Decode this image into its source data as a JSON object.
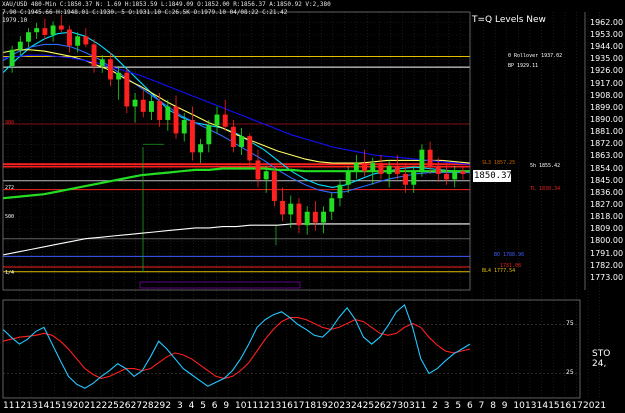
{
  "header": {
    "symbol_line": "XAU/USD 480-Min C:1850.37 N: 1.69 H:1853.59 L:1849.09 O:1852.00 R:1856.37 A:1850.92 V:2,380",
    "ohlc_line": "7.90 C:1945.66 H:1948.01 C:1930. 5 O:1931.10 C:26.5K O:1979.10 04/08:22 C:21.42",
    "corner_value": "1979.10"
  },
  "indicator_title": "T=Q Levels New",
  "current_price": "1850.37",
  "level_labels": [
    {
      "text": "0 Rollover 1937.02",
      "color": "#ffffff",
      "y": 1937.02,
      "x": 508
    },
    {
      "text": "BP 1929.11",
      "color": "#ffffff",
      "y": 1929.11,
      "x": 508
    },
    {
      "text": "SL3 1857.25",
      "color": "#c86400",
      "y": 1857.25,
      "x": 482
    },
    {
      "text": "5h 1855.42",
      "color": "#ffffff",
      "y": 1855.42,
      "x": 530
    },
    {
      "text": "TL 1838.34",
      "color": "#e02020",
      "y": 1838.34,
      "x": 530
    },
    {
      "text": "BO 1788.96",
      "color": "#3c5cff",
      "y": 1788.96,
      "x": 494
    },
    {
      "text": "1781.08",
      "color": "#e02020",
      "y": 1781.08,
      "x": 500
    },
    {
      "text": "BL4 1777.54",
      "color": "#e0c000",
      "y": 1777.54,
      "x": 482
    }
  ],
  "left_markers": [
    {
      "text": "900",
      "y": 1887,
      "color": "#e02020"
    },
    {
      "text": "272",
      "y": 1839,
      "color": "#ffffff"
    },
    {
      "text": "500",
      "y": 1817,
      "color": "#ffffff"
    },
    {
      "text": "1/4",
      "y": 1776,
      "color": "#ffffff"
    }
  ],
  "stochastic_label": "STO 24,",
  "chart_data": {
    "type": "line",
    "title": "XAU/USD 480-Min",
    "ylim": [
      1764,
      1970
    ],
    "y_ticks": [
      1773.0,
      1782.0,
      1791.0,
      1800.0,
      1809.0,
      1818.0,
      1827.0,
      1836.0,
      1845.0,
      1854.0,
      1863.0,
      1872.0,
      1881.0,
      1890.0,
      1899.0,
      1908.0,
      1917.0,
      1926.0,
      1935.0,
      1944.0,
      1953.0,
      1962.0
    ],
    "y_tick_labels": [
      "1773.00",
      "1782.00",
      "1791.00",
      "1800.00",
      "1809.00",
      "1818.00",
      "1827.00",
      "1836.00",
      "1845.00",
      "1854.00",
      "1863.00",
      "1872.00",
      "1881.00",
      "1890.00",
      "1899.00",
      "1908.00",
      "1917.00",
      "1926.00",
      "1935.00",
      "1944.00",
      "1953.00",
      "1962.00"
    ],
    "x_tick_labels": [
      "11",
      "12",
      "13",
      "14",
      "15",
      "19",
      "20",
      "21",
      "22",
      "25",
      "26",
      "27",
      "28",
      "29",
      "2",
      "3",
      "4",
      "5",
      "6",
      "9",
      "10",
      "11",
      "12",
      "13",
      "16",
      "17",
      "18",
      "19",
      "20",
      "23",
      "24",
      "25",
      "26",
      "27",
      "30",
      "31",
      "1",
      "2",
      "3",
      "5",
      "6",
      "7",
      "8",
      "9",
      "10",
      "13",
      "14",
      "15",
      "16",
      "17",
      "20",
      "21"
    ],
    "candles": [
      [
        1930,
        1945,
        1925,
        1942
      ],
      [
        1942,
        1952,
        1938,
        1948
      ],
      [
        1948,
        1958,
        1944,
        1955
      ],
      [
        1955,
        1962,
        1950,
        1958
      ],
      [
        1958,
        1965,
        1950,
        1953
      ],
      [
        1953,
        1963,
        1948,
        1960
      ],
      [
        1960,
        1968,
        1955,
        1957
      ],
      [
        1957,
        1960,
        1940,
        1945
      ],
      [
        1945,
        1955,
        1940,
        1952
      ],
      [
        1952,
        1958,
        1944,
        1946
      ],
      [
        1946,
        1950,
        1925,
        1930
      ],
      [
        1930,
        1938,
        1925,
        1935
      ],
      [
        1935,
        1940,
        1915,
        1920
      ],
      [
        1920,
        1930,
        1905,
        1925
      ],
      [
        1925,
        1928,
        1895,
        1900
      ],
      [
        1900,
        1910,
        1888,
        1905
      ],
      [
        1905,
        1912,
        1892,
        1896
      ],
      [
        1896,
        1908,
        1890,
        1904
      ],
      [
        1904,
        1910,
        1885,
        1890
      ],
      [
        1890,
        1905,
        1882,
        1900
      ],
      [
        1900,
        1908,
        1876,
        1880
      ],
      [
        1880,
        1895,
        1874,
        1890
      ],
      [
        1890,
        1900,
        1860,
        1866
      ],
      [
        1866,
        1876,
        1858,
        1872
      ],
      [
        1872,
        1890,
        1866,
        1886
      ],
      [
        1886,
        1900,
        1880,
        1894
      ],
      [
        1894,
        1905,
        1882,
        1885
      ],
      [
        1885,
        1890,
        1866,
        1870
      ],
      [
        1870,
        1884,
        1864,
        1878
      ],
      [
        1878,
        1880,
        1856,
        1860
      ],
      [
        1860,
        1868,
        1840,
        1846
      ],
      [
        1846,
        1856,
        1836,
        1852
      ],
      [
        1852,
        1856,
        1826,
        1830
      ],
      [
        1830,
        1840,
        1815,
        1820
      ],
      [
        1820,
        1834,
        1810,
        1828
      ],
      [
        1828,
        1832,
        1806,
        1812
      ],
      [
        1812,
        1826,
        1805,
        1822
      ],
      [
        1822,
        1830,
        1808,
        1814
      ],
      [
        1814,
        1826,
        1806,
        1822
      ],
      [
        1822,
        1836,
        1816,
        1832
      ],
      [
        1832,
        1846,
        1826,
        1842
      ],
      [
        1842,
        1856,
        1836,
        1852
      ],
      [
        1852,
        1864,
        1846,
        1858
      ],
      [
        1858,
        1868,
        1848,
        1852
      ],
      [
        1852,
        1862,
        1842,
        1858
      ],
      [
        1858,
        1864,
        1846,
        1850
      ],
      [
        1850,
        1860,
        1840,
        1856
      ],
      [
        1856,
        1864,
        1846,
        1850
      ],
      [
        1850,
        1858,
        1836,
        1842
      ],
      [
        1842,
        1856,
        1836,
        1852
      ],
      [
        1852,
        1872,
        1848,
        1868
      ],
      [
        1868,
        1874,
        1850,
        1856
      ],
      [
        1856,
        1862,
        1844,
        1850
      ],
      [
        1850,
        1858,
        1842,
        1846
      ],
      [
        1846,
        1856,
        1840,
        1852
      ],
      [
        1852,
        1856,
        1846,
        1850
      ]
    ],
    "series": [
      {
        "values": [
          1925,
          1935,
          1944,
          1950,
          1954,
          1955,
          1952,
          1946,
          1938,
          1928,
          1918,
          1908,
          1898,
          1892,
          1888,
          1886,
          1884,
          1880,
          1874,
          1868,
          1860,
          1852,
          1846,
          1842,
          1840,
          1842,
          1846,
          1850,
          1852,
          1854,
          1855,
          1854,
          1853,
          1852,
          1851
        ],
        "color": "#00e0ff"
      },
      {
        "values": [
          1934,
          1940,
          1944,
          1946,
          1946,
          1944,
          1940,
          1935,
          1928,
          1921,
          1914,
          1907,
          1900,
          1893,
          1888,
          1883,
          1878,
          1872,
          1866,
          1860,
          1853,
          1847,
          1842,
          1838,
          1836,
          1837,
          1840,
          1843,
          1846,
          1848,
          1850,
          1851,
          1851,
          1851,
          1851
        ],
        "color": "#2a6cff"
      },
      {
        "values": [
          1940,
          1942,
          1942,
          1941,
          1939,
          1937,
          1934,
          1930,
          1926,
          1920,
          1915,
          1909,
          1903,
          1898,
          1893,
          1888,
          1884,
          1879,
          1875,
          1871,
          1867,
          1864,
          1861,
          1859,
          1858,
          1858,
          1858,
          1859,
          1860,
          1860,
          1860,
          1860,
          1860,
          1859,
          1858
        ],
        "color": "#ffff66"
      },
      {
        "values": [
          1936,
          1937,
          1938,
          1938,
          1937,
          1936,
          1934,
          1932,
          1929,
          1926,
          1923,
          1919,
          1915,
          1911,
          1907,
          1903,
          1899,
          1895,
          1891,
          1887,
          1883,
          1879,
          1876,
          1873,
          1870,
          1868,
          1866,
          1864,
          1863,
          1862,
          1861,
          1860,
          1859,
          1858,
          1857
        ],
        "color": "#1010ff"
      },
      {
        "values": [
          1832,
          1833,
          1834,
          1835,
          1837,
          1839,
          1841,
          1843,
          1845,
          1847,
          1849,
          1850,
          1851,
          1852,
          1853,
          1853,
          1854,
          1854,
          1854,
          1854,
          1853,
          1853,
          1852,
          1852,
          1852,
          1852,
          1852,
          1852,
          1852,
          1852,
          1852,
          1852,
          1852,
          1852,
          1852
        ],
        "color": "#22dd22"
      },
      {
        "values": [
          1790,
          1792,
          1794,
          1796,
          1798,
          1800,
          1802,
          1803,
          1804,
          1805,
          1806,
          1807,
          1808,
          1809,
          1810,
          1810,
          1811,
          1811,
          1812,
          1812,
          1812,
          1813,
          1813,
          1813,
          1813,
          1813,
          1813,
          1813,
          1813,
          1813,
          1813,
          1813,
          1813,
          1813,
          1813
        ],
        "color": "#ffffff"
      }
    ],
    "horizontal_levels": [
      {
        "y": 1937.02,
        "color": "#e0c000"
      },
      {
        "y": 1929.11,
        "color": "#ffffff"
      },
      {
        "y": 1857.25,
        "color": "#ff2020"
      },
      {
        "y": 1855.42,
        "color": "#ff2020"
      },
      {
        "y": 1845,
        "color": "#c0c0c0"
      },
      {
        "y": 1838.34,
        "color": "#ff2020"
      },
      {
        "y": 1788.96,
        "color": "#3c5cff"
      },
      {
        "y": 1781.08,
        "color": "#ff2020"
      },
      {
        "y": 1777.54,
        "color": "#e0c000"
      },
      {
        "y": 1887,
        "color": "#801010"
      },
      {
        "y": 1802,
        "color": "#606060"
      }
    ],
    "stochastic": {
      "ylim": [
        0,
        100
      ],
      "levels": [
        25,
        75
      ],
      "level_labels": [
        "25",
        "75"
      ],
      "k": [
        70,
        62,
        55,
        60,
        68,
        72,
        55,
        38,
        22,
        14,
        10,
        15,
        22,
        28,
        35,
        30,
        22,
        28,
        42,
        58,
        50,
        40,
        30,
        24,
        18,
        12,
        16,
        20,
        28,
        40,
        55,
        72,
        80,
        85,
        88,
        82,
        75,
        70,
        64,
        62,
        70,
        82,
        92,
        80,
        62,
        55,
        62,
        74,
        88,
        95,
        72,
        40,
        25,
        30,
        38,
        45,
        50,
        55
      ],
      "d": [
        58,
        60,
        62,
        63,
        64,
        66,
        64,
        58,
        50,
        40,
        30,
        24,
        20,
        22,
        26,
        30,
        30,
        28,
        30,
        36,
        42,
        46,
        44,
        40,
        34,
        28,
        22,
        20,
        22,
        28,
        36,
        48,
        60,
        70,
        78,
        82,
        82,
        80,
        76,
        72,
        70,
        72,
        76,
        80,
        78,
        72,
        66,
        64,
        66,
        72,
        76,
        72,
        62,
        54,
        48,
        46,
        48,
        50
      ]
    }
  }
}
